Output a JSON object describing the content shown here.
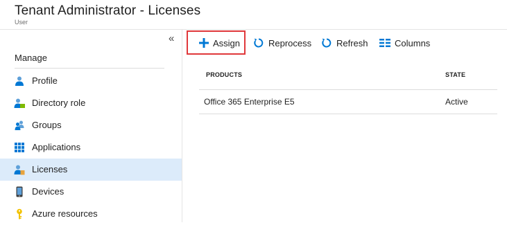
{
  "header": {
    "title": "Tenant Administrator - Licenses",
    "subtitle": "User"
  },
  "sidebar": {
    "collapse_glyph": "«",
    "section_heading": "Manage",
    "items": [
      {
        "label": "Profile",
        "icon": "user-profile-icon",
        "active": false
      },
      {
        "label": "Directory role",
        "icon": "directory-role-icon",
        "active": false
      },
      {
        "label": "Groups",
        "icon": "groups-icon",
        "active": false
      },
      {
        "label": "Applications",
        "icon": "applications-grid-icon",
        "active": false
      },
      {
        "label": "Licenses",
        "icon": "licenses-icon",
        "active": true
      },
      {
        "label": "Devices",
        "icon": "devices-icon",
        "active": false
      },
      {
        "label": "Azure resources",
        "icon": "key-icon",
        "active": false
      }
    ]
  },
  "toolbar": {
    "assign_label": "Assign",
    "reprocess_label": "Reprocess",
    "refresh_label": "Refresh",
    "columns_label": "Columns"
  },
  "table": {
    "columns": [
      "PRODUCTS",
      "STATE"
    ],
    "rows": [
      [
        "Office 365 Enterprise E5",
        "Active"
      ]
    ]
  },
  "colors": {
    "accent_blue": "#0078d4",
    "active_nav_bg": "#dcebfa",
    "highlight_red": "#e0373a"
  }
}
